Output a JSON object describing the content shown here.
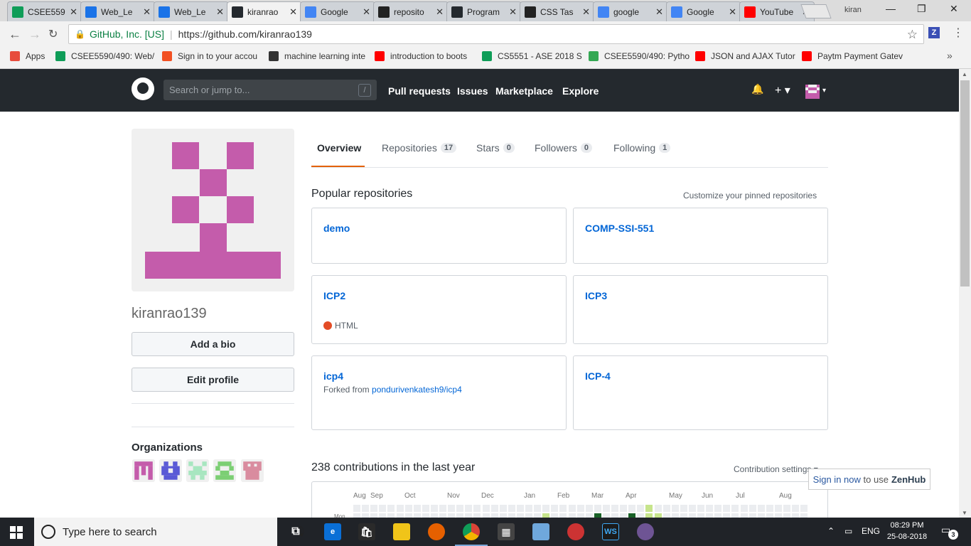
{
  "browser": {
    "tabs": [
      {
        "label": "CSEE559",
        "fav_color": "#0f9d58"
      },
      {
        "label": "Web_Le",
        "fav_color": "#1a73e8"
      },
      {
        "label": "Web_Le",
        "fav_color": "#1a73e8"
      },
      {
        "label": "kiranrao",
        "fav_color": "#24292e"
      },
      {
        "label": "Google",
        "fav_color": "#4285f4"
      },
      {
        "label": "reposito",
        "fav_color": "#222222"
      },
      {
        "label": "Program",
        "fav_color": "#24292e"
      },
      {
        "label": "CSS Tas",
        "fav_color": "#222222"
      },
      {
        "label": "google",
        "fav_color": "#4285f4"
      },
      {
        "label": "Google",
        "fav_color": "#4285f4"
      },
      {
        "label": "YouTube",
        "fav_color": "#ff0000"
      }
    ],
    "profile_name": "kiran",
    "site_identity": "GitHub, Inc. [US]",
    "url": "https://github.com/kiranrao139",
    "bookmarks": [
      {
        "label": "Apps"
      },
      {
        "label": "CSEE5590/490: Web/"
      },
      {
        "label": "Sign in to your accou"
      },
      {
        "label": "machine learning inte"
      },
      {
        "label": "introduction to boots"
      },
      {
        "label": "CS5551 - ASE 2018 S"
      },
      {
        "label": "CSEE5590/490: Pytho"
      },
      {
        "label": "JSON and AJAX Tutor"
      },
      {
        "label": "Paytm Payment Gatev"
      }
    ]
  },
  "github": {
    "search_placeholder": "Search or jump to...",
    "search_key": "/",
    "nav": [
      "Pull requests",
      "Issues",
      "Marketplace",
      "Explore"
    ],
    "plus": "+ ▾",
    "bell": "🔔"
  },
  "profile": {
    "username": "kiranrao139",
    "add_bio": "Add a bio",
    "edit_profile": "Edit profile",
    "organizations_title": "Organizations"
  },
  "tabs": [
    {
      "label": "Overview",
      "count": ""
    },
    {
      "label": "Repositories",
      "count": "17"
    },
    {
      "label": "Stars",
      "count": "0"
    },
    {
      "label": "Followers",
      "count": "0"
    },
    {
      "label": "Following",
      "count": "1"
    }
  ],
  "popular": {
    "title": "Popular repositories",
    "customize": "Customize your pinned repositories",
    "repos": [
      {
        "name": "demo"
      },
      {
        "name": "COMP-SSI-551"
      },
      {
        "name": "ICP2",
        "language": "HTML",
        "language_color": "#e34c26"
      },
      {
        "name": "ICP3"
      },
      {
        "name": "icp4",
        "fork_prefix": "Forked from ",
        "fork_source": "pondurivenkatesh9/icp4"
      },
      {
        "name": "ICP-4"
      }
    ]
  },
  "contributions": {
    "title": "238 contributions in the last year",
    "settings": "Contribution settings ▾",
    "months": [
      "Aug",
      "Sep",
      "Oct",
      "Nov",
      "Dec",
      "Jan",
      "Feb",
      "Mar",
      "Apr",
      "May",
      "Jun",
      "Jul",
      "Aug"
    ],
    "day_label": "Mon"
  },
  "zenhub": {
    "link": "Sign in now",
    "text": "to use",
    "brand": "ZenHub"
  },
  "taskbar": {
    "search_placeholder": "Type here to search",
    "language": "ENG",
    "time": "08:29 PM",
    "date": "25-08-2018",
    "notifications": "3"
  },
  "colors": {
    "accent": "#e36209",
    "link": "#0366d6",
    "avatar": "#c45cab"
  }
}
